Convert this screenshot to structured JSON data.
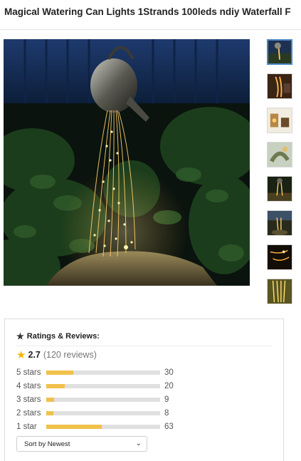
{
  "product": {
    "title": "Magical Watering Can Lights 1Strands 100leds ndiy Waterfall F"
  },
  "gallery": {
    "thumbnails": [
      {
        "icon": "thumb-image-1",
        "active": true
      },
      {
        "icon": "thumb-image-2",
        "active": false
      },
      {
        "icon": "thumb-image-3",
        "active": false
      },
      {
        "icon": "thumb-image-4",
        "active": false
      },
      {
        "icon": "thumb-image-5",
        "active": false
      },
      {
        "icon": "thumb-image-6",
        "active": false
      },
      {
        "icon": "thumb-image-7",
        "active": false
      },
      {
        "icon": "thumb-image-8",
        "active": false
      }
    ]
  },
  "reviews": {
    "heading": "Ratings & Reviews:",
    "heading_icon": "star-icon",
    "average": "2.7",
    "count_text": "(120 reviews)",
    "accent_color": "#f0c14b",
    "breakdown": [
      {
        "label": "5 stars",
        "count": "30",
        "fraction": 0.24
      },
      {
        "label": "4 stars",
        "count": "20",
        "fraction": 0.16
      },
      {
        "label": "3 stars",
        "count": "9",
        "fraction": 0.07
      },
      {
        "label": "2 stars",
        "count": "8",
        "fraction": 0.06
      },
      {
        "label": "1 star",
        "count": "63",
        "fraction": 0.49
      }
    ],
    "sort": {
      "selected": "Sort by Newest"
    }
  }
}
